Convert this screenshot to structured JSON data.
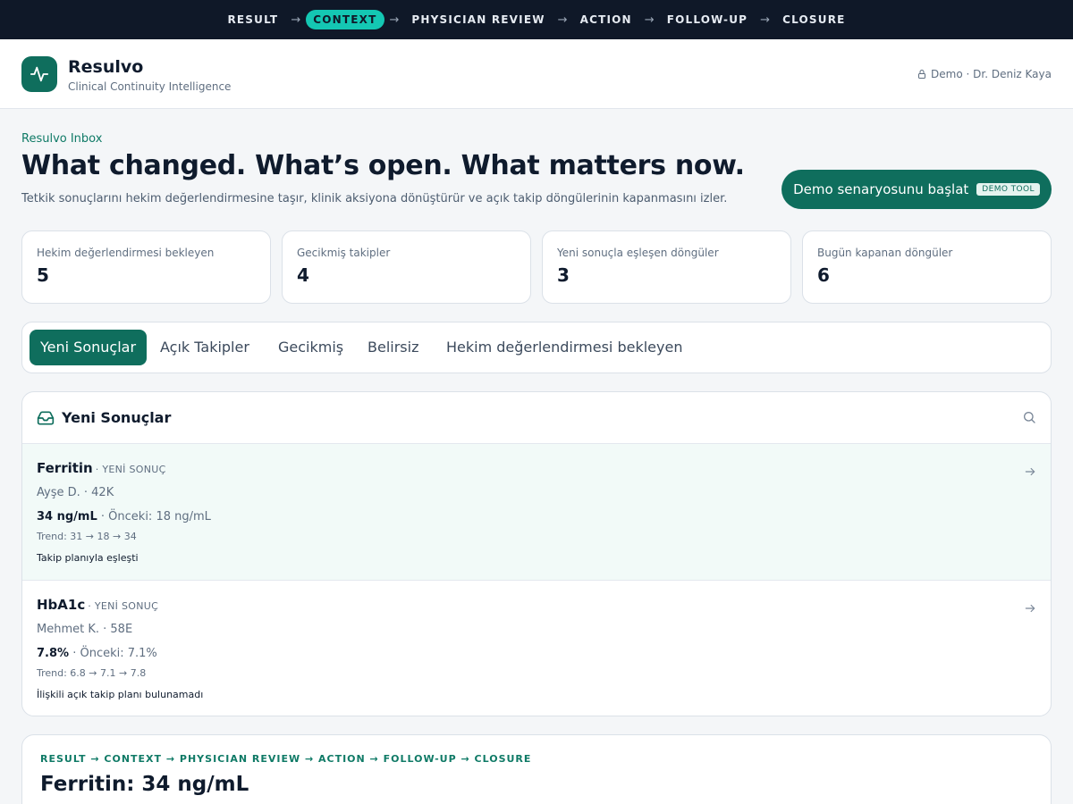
{
  "pipeline": {
    "steps": [
      "RESULT",
      "CONTEXT",
      "PHYSICIAN REVIEW",
      "ACTION",
      "FOLLOW-UP",
      "CLOSURE"
    ],
    "active": "CONTEXT"
  },
  "header": {
    "brand": "Resulvo",
    "subtitle": "Clinical Continuity Intelligence",
    "user": "Demo · Dr. Deniz Kaya"
  },
  "hero": {
    "eyebrow": "Resulvo Inbox",
    "title": "What changed. What’s open. What matters now.",
    "description": "Tetkik sonuçlarını hekim değerlendirmesine taşır, klinik aksiyona dönüştürür ve açık takip döngülerinin kapanmasını izler.",
    "demo_button": "Demo senaryosunu başlat",
    "demo_tag": "DEMO TOOL"
  },
  "stats": [
    {
      "label": "Hekim değerlendirmesi bekleyen",
      "value": "5"
    },
    {
      "label": "Gecikmiş takipler",
      "value": "4"
    },
    {
      "label": "Yeni sonuçla eşleşen döngüler",
      "value": "3"
    },
    {
      "label": "Bugün kapanan döngüler",
      "value": "6"
    }
  ],
  "tabs": [
    "Yeni Sonuçlar",
    "Açık Takipler",
    "Gecikmiş",
    "Belirsiz",
    "Hekim değerlendirmesi bekleyen"
  ],
  "panel": {
    "title": "Yeni Sonuçlar",
    "rows": [
      {
        "name": "Ferritin",
        "badge": "· YENİ SONUÇ",
        "patient": "Ayşe D. · 42K",
        "value": "34 ng/mL",
        "previous": "· Önceki: 18 ng/mL",
        "trend": "Trend: 31 → 18 → 34",
        "note": "Takip planıyla eşleşti"
      },
      {
        "name": "HbA1c",
        "badge": "· YENİ SONUÇ",
        "patient": "Mehmet K. · 58E",
        "value": "7.8%",
        "previous": "· Önceki: 7.1%",
        "trend": "Trend: 6.8 → 7.1 → 7.8",
        "note": "İlişkili açık takip planı bulunamadı"
      }
    ]
  },
  "detail": {
    "pipeline": "RESULT → CONTEXT → PHYSICIAN REVIEW → ACTION → FOLLOW-UP → CLOSURE",
    "title": "Ferritin: 34 ng/mL"
  },
  "colors": {
    "brand": "#0f6e5d",
    "accent": "#14c7b3",
    "topbar": "#0f1828"
  }
}
